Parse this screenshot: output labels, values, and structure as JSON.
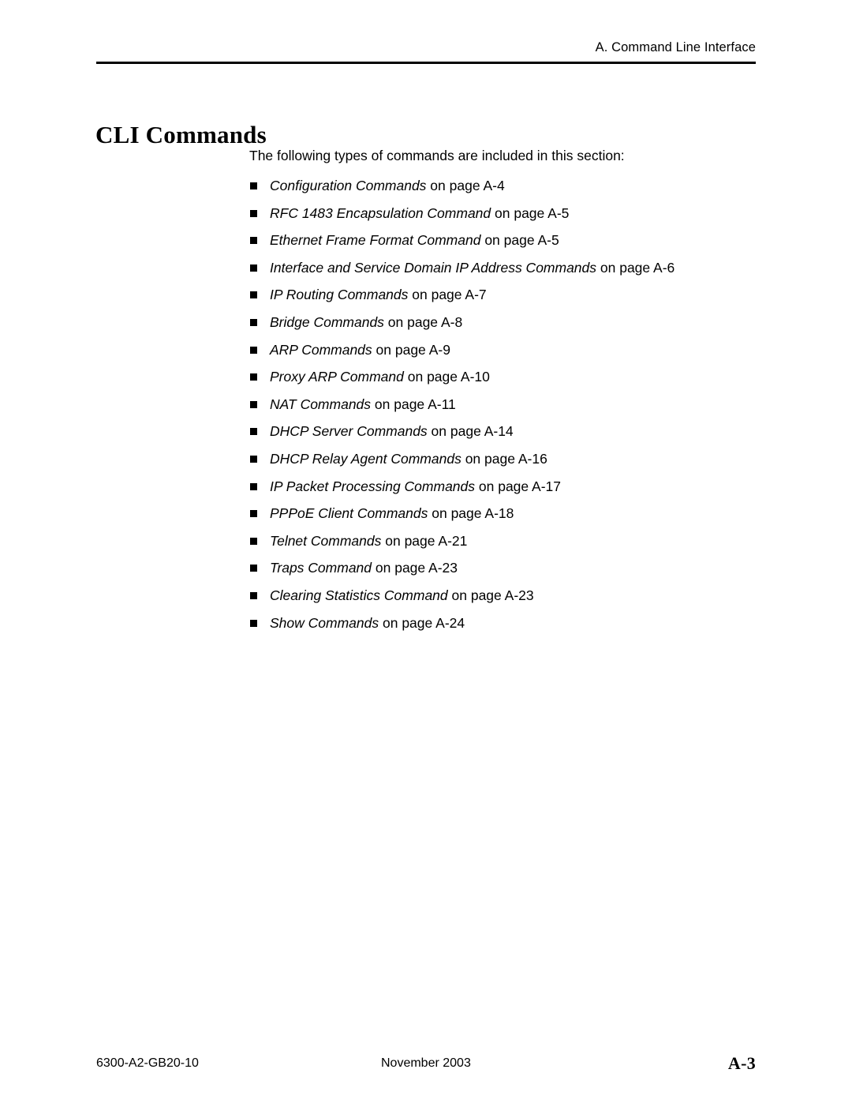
{
  "header": {
    "running_head": "A. Command Line Interface"
  },
  "title": {
    "text": "CLI Commands"
  },
  "intro": {
    "text": "The following types of commands are included in this section:"
  },
  "bullets": [
    {
      "title": "Configuration Commands",
      "suffix": " on page A-4"
    },
    {
      "title": "RFC 1483 Encapsulation Command",
      "suffix": " on page A-5"
    },
    {
      "title": "Ethernet Frame Format Command",
      "suffix": " on page A-5"
    },
    {
      "title": "Interface and Service Domain IP Address Commands",
      "suffix": " on page A-6"
    },
    {
      "title": "IP Routing Commands",
      "suffix": " on page A-7"
    },
    {
      "title": "Bridge Commands",
      "suffix": " on page A-8"
    },
    {
      "title": "ARP Commands",
      "suffix": " on page A-9"
    },
    {
      "title": "Proxy ARP Command",
      "suffix": " on page A-10"
    },
    {
      "title": "NAT Commands",
      "suffix": " on page A-11"
    },
    {
      "title": "DHCP Server Commands",
      "suffix": " on page A-14"
    },
    {
      "title": "DHCP Relay Agent Commands",
      "suffix": " on page A-16"
    },
    {
      "title": "IP Packet Processing Commands",
      "suffix": " on page A-17"
    },
    {
      "title": "PPPoE Client Commands",
      "suffix": " on page A-18"
    },
    {
      "title": "Telnet Commands",
      "suffix": " on page A-21"
    },
    {
      "title": "Traps Command",
      "suffix": " on page A-23"
    },
    {
      "title": "Clearing Statistics Command",
      "suffix": " on page A-23"
    },
    {
      "title": "Show Commands",
      "suffix": " on page A-24"
    }
  ],
  "footer": {
    "document_number": "6300-A2-GB20-10",
    "date": "November 2003",
    "page_number": "A-3"
  }
}
